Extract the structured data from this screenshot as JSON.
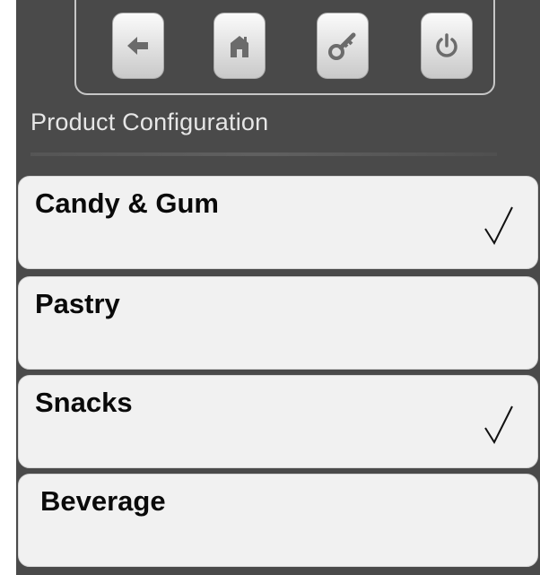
{
  "toolbar": {
    "buttons": [
      {
        "icon": "back-arrow-icon"
      },
      {
        "icon": "home-icon"
      },
      {
        "icon": "key-icon"
      },
      {
        "icon": "power-icon"
      }
    ]
  },
  "header": {
    "title": "Product Configuration"
  },
  "categories": [
    {
      "label": "Candy & Gum",
      "checked": true
    },
    {
      "label": "Pastry",
      "checked": false
    },
    {
      "label": "Snacks",
      "checked": true
    },
    {
      "label": "Beverage",
      "checked": false
    }
  ],
  "colors": {
    "screen_background": "#4a4a4a",
    "button_face": "#f1f1f1",
    "icon": "#6b6b6b"
  }
}
